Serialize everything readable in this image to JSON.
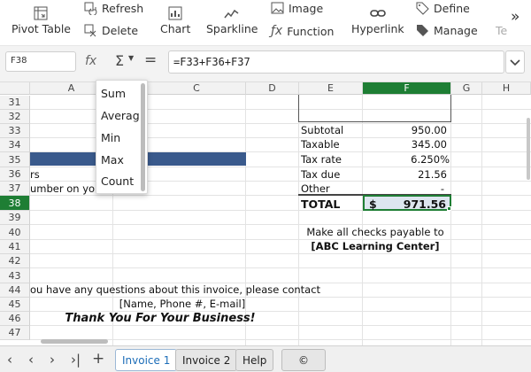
{
  "toolbar": {
    "pivot": "Pivot Table",
    "refresh": "Refresh",
    "delete": "Delete",
    "chart": "Chart",
    "sparkline": "Sparkline",
    "image": "Image",
    "function": "Function",
    "hyperlink": "Hyperlink",
    "define": "Define",
    "manage": "Manage",
    "more": "Te"
  },
  "formula": {
    "cell_ref": "F38",
    "fx": "fx",
    "sigma": "Σ",
    "equals": "=",
    "value": "=F33+F36+F37"
  },
  "columns": [
    "A",
    "B",
    "C",
    "D",
    "E",
    "F",
    "G",
    "H"
  ],
  "rows": [
    "31",
    "32",
    "33",
    "34",
    "35",
    "36",
    "37",
    "38",
    "39",
    "40",
    "41",
    "42",
    "43",
    "44",
    "45",
    "46",
    "47"
  ],
  "cells": {
    "subtotal_label": "Subtotal",
    "subtotal_val": "950.00",
    "taxable_label": "Taxable",
    "taxable_val": "345.00",
    "taxrate_label": "Tax rate",
    "taxrate_val": "6.250%",
    "taxdue_label": "Tax due",
    "taxdue_val": "21.56",
    "other_label": "Other",
    "other_val": "-",
    "total_label": "TOTAL",
    "total_currency": "$",
    "total_val": "971.56",
    "a36": "rs",
    "a37": "umber on you",
    "checks": "Make all checks payable to",
    "center": "[ABC Learning Center]",
    "questions": "ou have any questions about this invoice, please contact",
    "contact": "[Name, Phone #, E-mail]",
    "thanks": "Thank You For Your Business!"
  },
  "autosum_menu": [
    "Sum",
    "Averag",
    "Min",
    "Max",
    "Count"
  ],
  "sheets": [
    "Invoice 1",
    "Invoice 2",
    "Help",
    "©"
  ],
  "colors": {
    "accent": "#1e7e34",
    "header_blue": "#3a5a8c",
    "tab_active": "#1c6db8",
    "total_bg": "#dde6ef"
  }
}
